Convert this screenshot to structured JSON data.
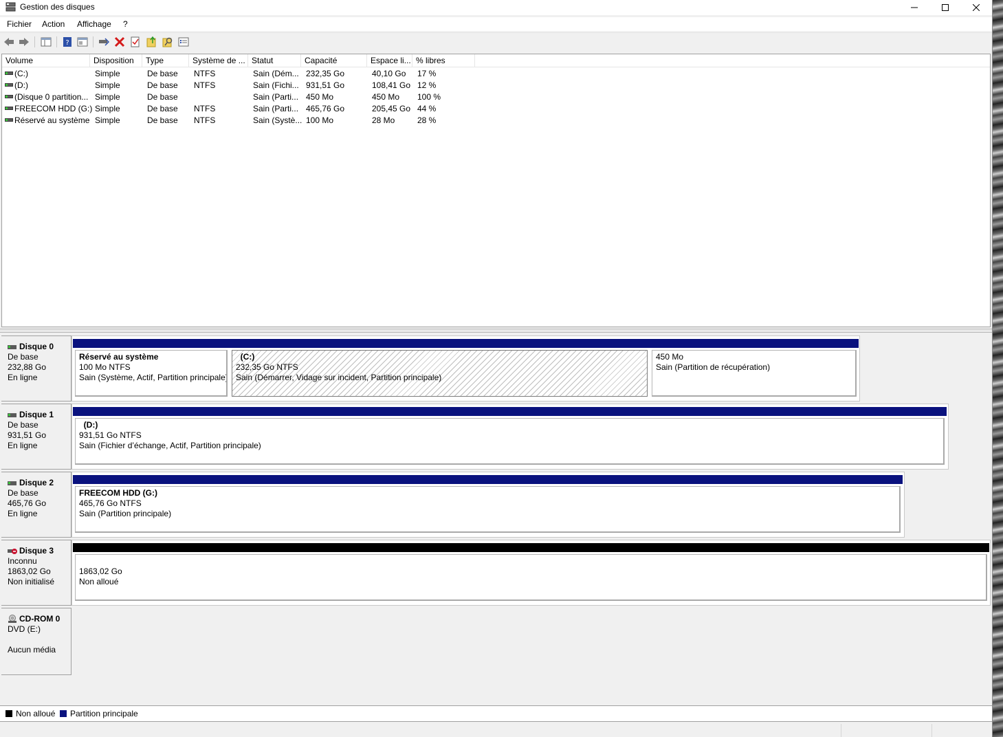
{
  "window": {
    "title": "Gestion des disques"
  },
  "menu": [
    "Fichier",
    "Action",
    "Affichage",
    "?"
  ],
  "toolbar": [
    "back-icon",
    "forward-icon",
    "console-tree-icon",
    "help-icon",
    "properties-icon",
    "disk-icon",
    "delete-icon",
    "check-icon",
    "refresh-icon",
    "search-icon",
    "list-icon"
  ],
  "volume_list": {
    "columns": [
      "Volume",
      "Disposition",
      "Type",
      "Système de ...",
      "Statut",
      "Capacité",
      "Espace li...",
      "% libres"
    ],
    "rows": [
      [
        "(C:)",
        "Simple",
        "De base",
        "NTFS",
        "Sain (Dém...",
        "232,35 Go",
        "40,10 Go",
        "17 %"
      ],
      [
        "(D:)",
        "Simple",
        "De base",
        "NTFS",
        "Sain (Fichi...",
        "931,51 Go",
        "108,41 Go",
        "12 %"
      ],
      [
        "(Disque 0 partition...",
        "Simple",
        "De base",
        "",
        "Sain (Parti...",
        "450 Mo",
        "450 Mo",
        "100 %"
      ],
      [
        "FREECOM HDD (G:)",
        "Simple",
        "De base",
        "NTFS",
        "Sain (Parti...",
        "465,76 Go",
        "205,45 Go",
        "44 %"
      ],
      [
        "Réservé au système",
        "Simple",
        "De base",
        "NTFS",
        "Sain (Systè...",
        "100 Mo",
        "28 Mo",
        "28 %"
      ]
    ]
  },
  "disks": [
    {
      "name": "Disque 0",
      "type": "De base",
      "size": "232,88 Go",
      "state": "En ligne",
      "partitions": [
        {
          "title": "Réservé au système",
          "size": "100 Mo NTFS",
          "status": "Sain (Système, Actif, Partition principale)"
        },
        {
          "title": "(C:)",
          "size": "232,35 Go NTFS",
          "status": "Sain (Démarrer, Vidage sur incident, Partition principale)"
        },
        {
          "title": "",
          "size": "450 Mo",
          "status": "Sain (Partition de récupération)"
        }
      ]
    },
    {
      "name": "Disque 1",
      "type": "De base",
      "size": "931,51 Go",
      "state": "En ligne",
      "partitions": [
        {
          "title": "(D:)",
          "size": "931,51 Go NTFS",
          "status": "Sain (Fichier d’échange, Actif, Partition principale)"
        }
      ]
    },
    {
      "name": "Disque 2",
      "type": "De base",
      "size": "465,76 Go",
      "state": "En ligne",
      "partitions": [
        {
          "title": "FREECOM HDD  (G:)",
          "size": "465,76 Go NTFS",
          "status": "Sain (Partition principale)"
        }
      ]
    },
    {
      "name": "Disque 3",
      "type": "Inconnu",
      "size": "1863,02 Go",
      "state": "Non initialisé",
      "partitions": [
        {
          "title": "",
          "size": "1863,02 Go",
          "status": "Non alloué"
        }
      ]
    },
    {
      "name": "CD-ROM 0",
      "type": "DVD (E:)",
      "size": "",
      "state": "Aucun média",
      "partitions": []
    }
  ],
  "legend": [
    {
      "label": "Non alloué",
      "color": "#000000"
    },
    {
      "label": "Partition principale",
      "color": "#0a127e"
    }
  ]
}
